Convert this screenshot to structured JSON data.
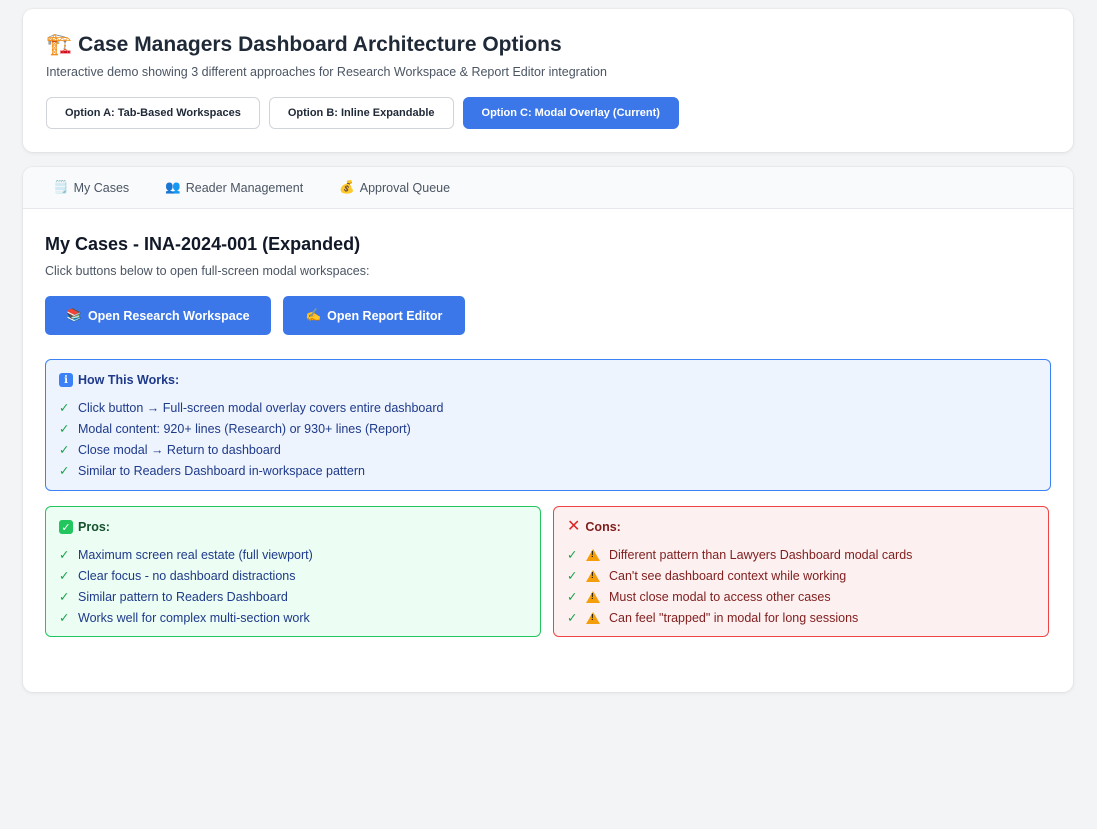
{
  "header": {
    "icon": "construction-crane-icon",
    "title": "Case Managers Dashboard Architecture Options",
    "subtitle": "Interactive demo showing 3 different approaches for Research Workspace & Report Editor integration",
    "options": [
      {
        "label": "Option A: Tab-Based Workspaces",
        "active": false
      },
      {
        "label": "Option B: Inline Expandable",
        "active": false
      },
      {
        "label": "Option C: Modal Overlay (Current)",
        "active": true
      }
    ]
  },
  "tabs": [
    {
      "icon": "notepad-icon",
      "glyph": "🗒️",
      "label": "My Cases"
    },
    {
      "icon": "people-icon",
      "glyph": "👥",
      "label": "Reader Management"
    },
    {
      "icon": "money-bag-icon",
      "glyph": "💰",
      "label": "Approval Queue"
    }
  ],
  "main": {
    "title": "My Cases - INA-2024-001 (Expanded)",
    "subtitle": "Click buttons below to open full-screen modal workspaces:",
    "research_button": {
      "glyph": "📚",
      "label": "Open Research Workspace"
    },
    "report_button": {
      "glyph": "✍️",
      "label": "Open Report Editor"
    }
  },
  "how": {
    "glyph": "i",
    "title": "How This Works:",
    "items": [
      "Click button → Full-screen modal overlay covers entire dashboard",
      "Modal content: 920+ lines (Research) or 930+ lines (Report)",
      "Close modal → Return to dashboard",
      "Similar to Readers Dashboard in-workspace pattern"
    ]
  },
  "pros": {
    "glyph": "✓",
    "title": "Pros:",
    "items": [
      "Maximum screen real estate (full viewport)",
      "Clear focus - no dashboard distractions",
      "Similar pattern to Readers Dashboard",
      "Works well for complex multi-section work"
    ]
  },
  "cons": {
    "glyph": "✕",
    "title": "Cons:",
    "items": [
      "Different pattern than Lawyers Dashboard modal cards",
      "Can't see dashboard context while working",
      "Must close modal to access other cases",
      "Can feel \"trapped\" in modal for long sessions"
    ]
  },
  "check_glyph": "✓",
  "colors": {
    "accent": "#3b77e8",
    "info_border": "#3b82f6",
    "pros_border": "#22c55e",
    "cons_border": "#ef4444"
  }
}
